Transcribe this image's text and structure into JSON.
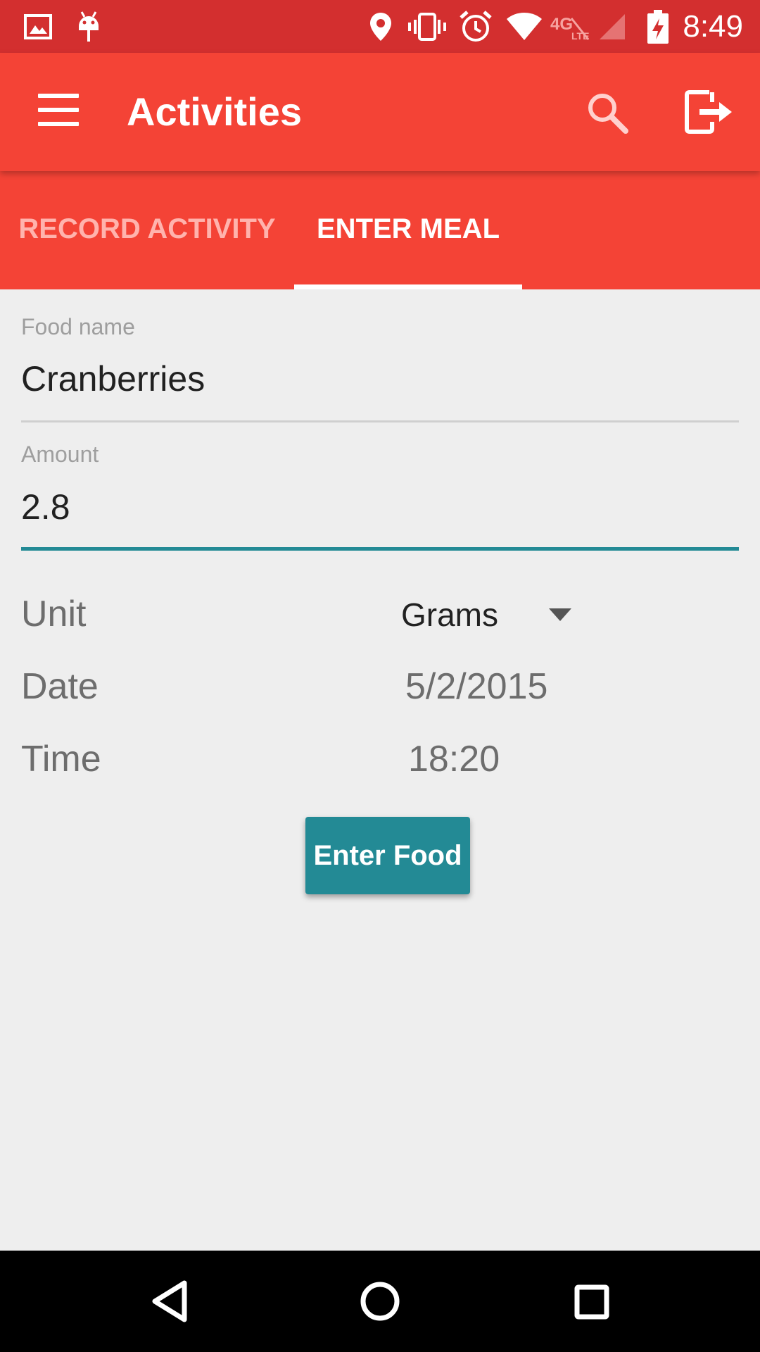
{
  "status_bar": {
    "time": "8:49",
    "icons": [
      "image-icon",
      "android-icon",
      "location-icon",
      "vibrate-icon",
      "alarm-icon",
      "wifi-icon",
      "4g-lte-icon",
      "signal-icon",
      "battery-charging-icon"
    ]
  },
  "app_bar": {
    "title": "Activities",
    "icons": [
      "menu-icon",
      "search-icon",
      "logout-icon"
    ]
  },
  "tabs": [
    {
      "label": "RECORD ACTIVITY",
      "selected": false
    },
    {
      "label": "ENTER MEAL",
      "selected": true
    }
  ],
  "form": {
    "food_name": {
      "label": "Food name",
      "value": "Cranberries"
    },
    "amount": {
      "label": "Amount",
      "value": "2.8"
    },
    "unit": {
      "label": "Unit",
      "value": "Grams"
    },
    "date": {
      "label": "Date",
      "value": "5/2/2015"
    },
    "time": {
      "label": "Time",
      "value": "18:20"
    },
    "submit_label": "Enter Food"
  },
  "nav_bar": {
    "icons": [
      "back-icon",
      "home-icon",
      "recents-icon"
    ]
  },
  "colors": {
    "status_bar": "#d32f2f",
    "primary": "#f44336",
    "accent": "#238a95",
    "background": "#eeeeee"
  }
}
